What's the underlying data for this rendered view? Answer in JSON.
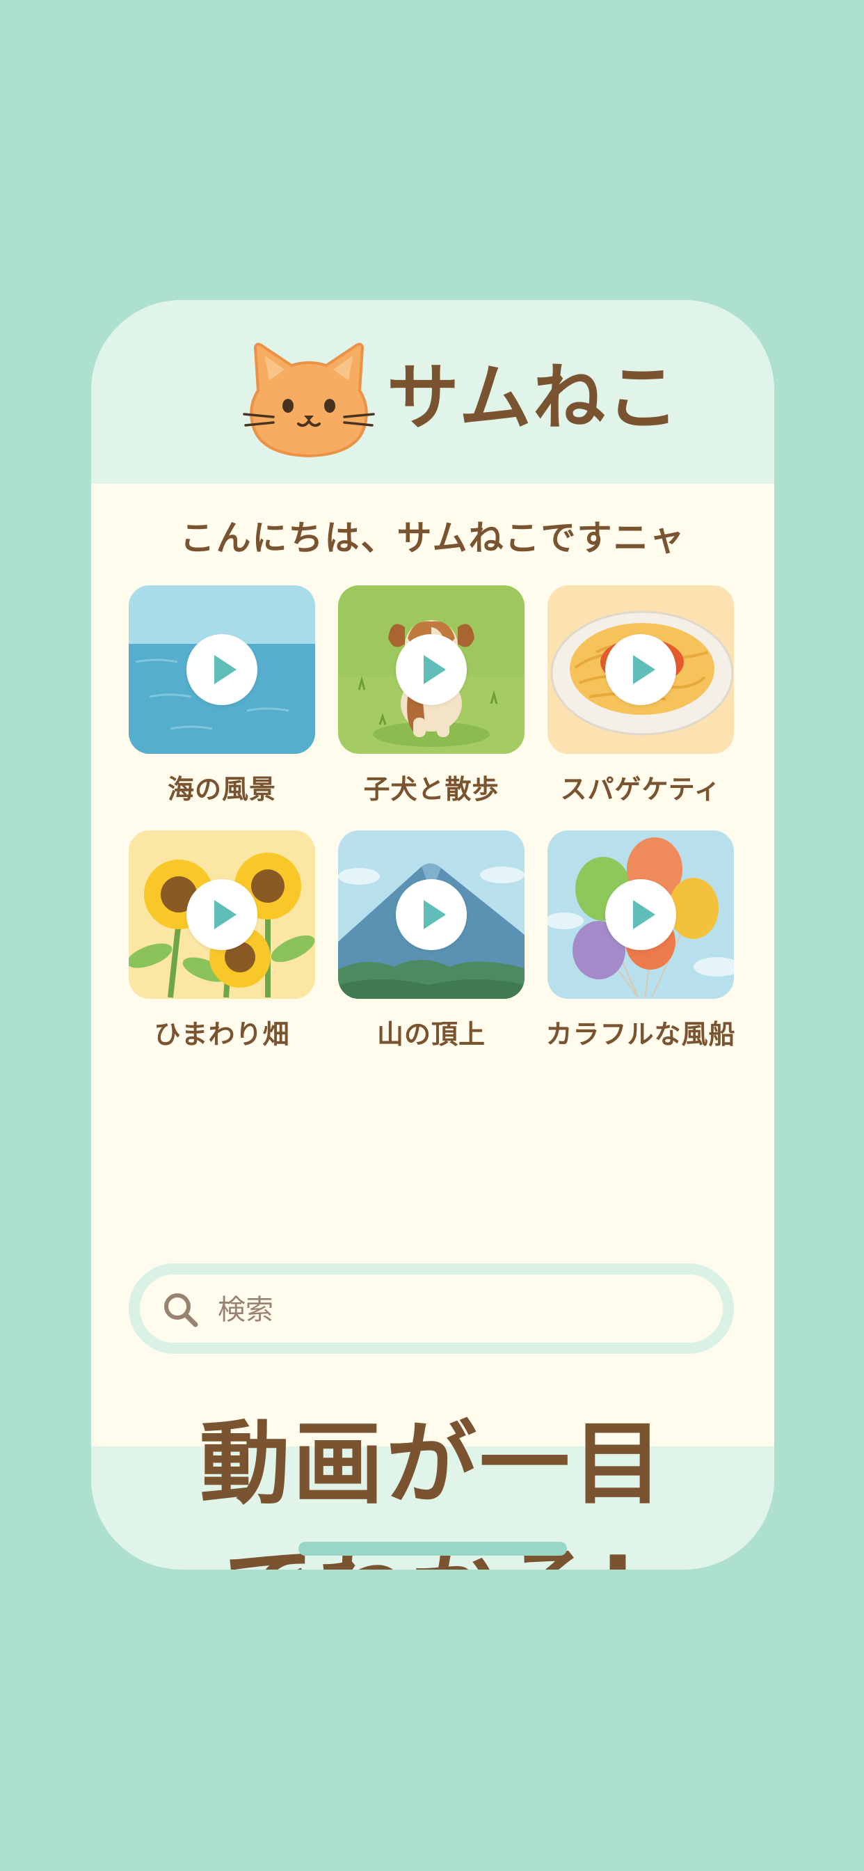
{
  "app": {
    "title": "サムねこ",
    "greeting": "こんにちは、サムねこですニャ"
  },
  "videos": [
    {
      "label": "海の風景",
      "scene": "ocean"
    },
    {
      "label": "子犬と散歩",
      "scene": "puppy"
    },
    {
      "label": "スパゲケティ",
      "scene": "spaghetti"
    },
    {
      "label": "ひまわり畑",
      "scene": "sunflowers"
    },
    {
      "label": "山の頂上",
      "scene": "mountain"
    },
    {
      "label": "カラフルな風船",
      "scene": "balloons"
    }
  ],
  "search": {
    "placeholder": "検索",
    "icon": "search-icon"
  },
  "promo": {
    "line1": "動画が一目",
    "line2": "でわかる!"
  },
  "colors": {
    "background": "#ade0cf",
    "phone_frame": "#e1f4ea",
    "content_bg": "#fffcee",
    "brand_text": "#7a5430",
    "play_icon": "#5fbfb8",
    "cat_orange": "#f6ad62"
  }
}
